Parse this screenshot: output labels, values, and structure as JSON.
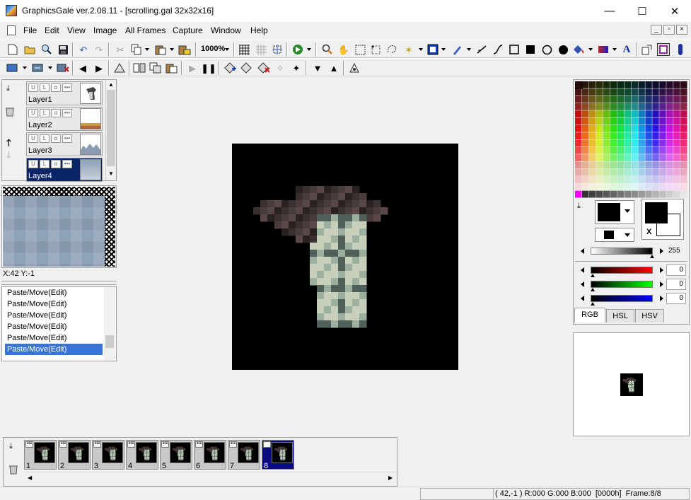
{
  "window": {
    "title": "GraphicsGale ver.2.08.11 - [scrolling.gal 32x32x16]",
    "minimize": "—",
    "maximize": "☐",
    "close": "✕"
  },
  "menu": [
    "File",
    "Edit",
    "View",
    "Image",
    "All Frames",
    "Capture",
    "Window",
    "Help"
  ],
  "mdi_controls": [
    "_",
    "▫",
    "×"
  ],
  "toolbar": {
    "zoom_value": "1000%"
  },
  "layers": [
    {
      "label": "Layer1",
      "selected": false
    },
    {
      "label": "Layer2",
      "selected": false
    },
    {
      "label": "Layer3",
      "selected": false
    },
    {
      "label": "Layer4",
      "selected": true
    }
  ],
  "layer_buttons": [
    "U",
    "L",
    "α",
    "•••"
  ],
  "coords": "X:42 Y:-1",
  "history": [
    {
      "label": "Paste/Move(Edit)",
      "selected": false
    },
    {
      "label": "Paste/Move(Edit)",
      "selected": false
    },
    {
      "label": "Paste/Move(Edit)",
      "selected": false
    },
    {
      "label": "Paste/Move(Edit)",
      "selected": false
    },
    {
      "label": "Paste/Move(Edit)",
      "selected": false
    },
    {
      "label": "Paste/Move(Edit)",
      "selected": true
    }
  ],
  "frames": [
    {
      "number": "1",
      "selected": false
    },
    {
      "number": "2",
      "selected": false
    },
    {
      "number": "3",
      "selected": false
    },
    {
      "number": "4",
      "selected": false
    },
    {
      "number": "5",
      "selected": false
    },
    {
      "number": "6",
      "selected": false
    },
    {
      "number": "7",
      "selected": false
    },
    {
      "number": "8",
      "selected": true
    }
  ],
  "color_panel": {
    "alpha_value": "255",
    "r_value": "0",
    "g_value": "0",
    "b_value": "0",
    "tabs": [
      "RGB",
      "HSL",
      "HSV"
    ],
    "selected_tab": "RGB",
    "swap_label": "X"
  },
  "status": "( 42,-1 ) R:000 G:000 B:000  [0000h]  Frame:8/8",
  "colors": {
    "selection": "#0a246a",
    "highlight": "#3874d8",
    "sky": "#8ea2b8",
    "ground": "#c8a050"
  }
}
